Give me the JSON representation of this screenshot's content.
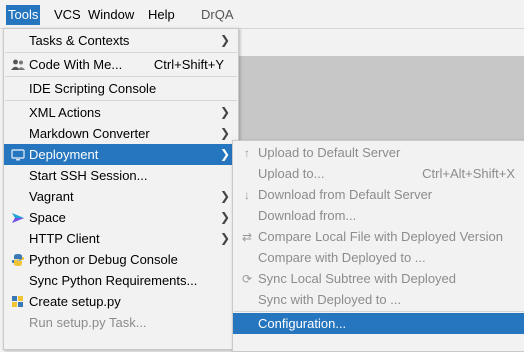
{
  "menubar": {
    "tools": "Tools",
    "vcs": "VCS",
    "window": "Window",
    "help": "Help",
    "project": "DrQA"
  },
  "tools_menu": {
    "tasks": "Tasks & Contexts",
    "code_with_me": "Code With Me...",
    "code_with_me_shortcut": "Ctrl+Shift+Y",
    "ide_scripting": "IDE Scripting Console",
    "xml_actions": "XML Actions",
    "markdown": "Markdown Converter",
    "deployment": "Deployment",
    "ssh": "Start SSH Session...",
    "vagrant": "Vagrant",
    "space": "Space",
    "http_client": "HTTP Client",
    "python_console": "Python or Debug Console",
    "sync_requirements": "Sync Python Requirements...",
    "create_setup": "Create setup.py",
    "run_setup": "Run setup.py Task..."
  },
  "deployment_menu": {
    "upload_default": "Upload to Default Server",
    "upload_to": "Upload to...",
    "upload_to_shortcut": "Ctrl+Alt+Shift+X",
    "download_default": "Download from Default Server",
    "download_from": "Download from...",
    "compare_local": "Compare Local File with Deployed Version",
    "compare_with": "Compare with Deployed to ...",
    "sync_local": "Sync Local Subtree with Deployed",
    "sync_with": "Sync with Deployed to ...",
    "configuration": "Configuration..."
  }
}
